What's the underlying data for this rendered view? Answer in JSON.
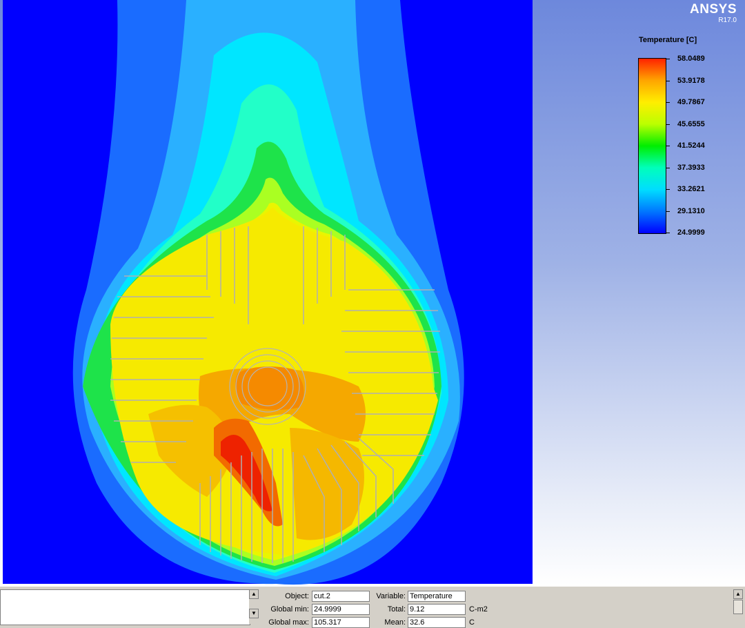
{
  "brand": {
    "name": "ANSYS",
    "revision": "R17.0"
  },
  "legend": {
    "title": "Temperature [C]",
    "ticks": [
      "58.0489",
      "53.9178",
      "49.7867",
      "45.6555",
      "41.5244",
      "37.3933",
      "33.2621",
      "29.1310",
      "24.9999"
    ],
    "colors": [
      "#ff2200",
      "#ffa500",
      "#ffee00",
      "#bbff00",
      "#00ee00",
      "#00ffbb",
      "#00ddff",
      "#0077ff",
      "#0000ff"
    ]
  },
  "colors": {
    "background_fluid": "#0000ff",
    "fin_line": "#b0b0b0"
  },
  "panel": {
    "object_label": "Object:",
    "object_value": "cut.2",
    "gmin_label": "Global min:",
    "gmin_value": "24.9999",
    "gmax_label": "Global max:",
    "gmax_value": "105.317",
    "variable_label": "Variable:",
    "variable_value": "Temperature",
    "total_label": "Total:",
    "total_value": "9.12",
    "total_unit": "C-m2",
    "mean_label": "Mean:",
    "mean_value": "32.6",
    "mean_unit": "C"
  }
}
